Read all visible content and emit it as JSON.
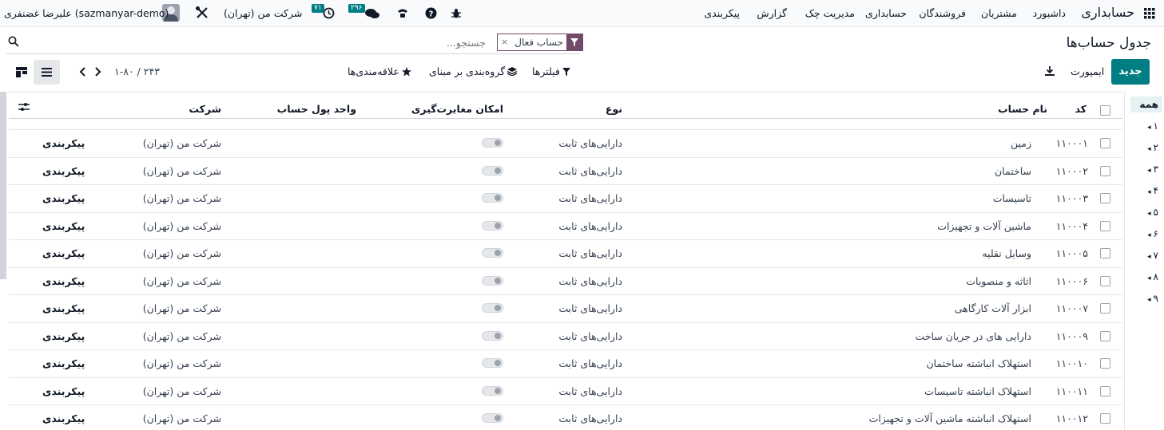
{
  "navbar": {
    "app_name": "حسابداری",
    "menu": [
      "داشبورد",
      "مشتریان",
      "فروشندگان",
      "حسابداری",
      "مدیریت چک",
      "گزارش",
      "پیکربندی"
    ],
    "activity_count": "۲۹۶",
    "clock_count": "۷۱",
    "company": "شرکت من (تهران)",
    "user": "علیرضا غضنفری (sazmanyar-demo)"
  },
  "control": {
    "breadcrumb": "جدول حساب‌ها",
    "new_button": "جدید",
    "import_label": "ایمپورت",
    "facet_label": "حساب فعال",
    "search_placeholder": "جستجو...",
    "filters_label": "فیلترها",
    "groupby_label": "گروه‌بندی بر مبنای",
    "favorites_label": "علاقه‌مندی‌ها",
    "pager": "۱-۸۰ / ۲۴۳"
  },
  "table": {
    "headers": {
      "code": "کد",
      "name": "نام حساب",
      "type": "نوع",
      "reconcile": "امکان مغایرت‌گیری",
      "currency": "واحد پول حساب",
      "company": "شرکت"
    },
    "rows": [
      {
        "code": "۱۱۰۰۰۱",
        "name": "زمین",
        "type": "دارایی‌های ثابت",
        "company": "شرکت من (تهران)",
        "action": "پیکربندی"
      },
      {
        "code": "۱۱۰۰۰۲",
        "name": "ساختمان",
        "type": "دارایی‌های ثابت",
        "company": "شرکت من (تهران)",
        "action": "پیکربندی"
      },
      {
        "code": "۱۱۰۰۰۳",
        "name": "تاسیسات",
        "type": "دارایی‌های ثابت",
        "company": "شرکت من (تهران)",
        "action": "پیکربندی"
      },
      {
        "code": "۱۱۰۰۰۴",
        "name": "ماشین آلات و تجهیزات",
        "type": "دارایی‌های ثابت",
        "company": "شرکت من (تهران)",
        "action": "پیکربندی"
      },
      {
        "code": "۱۱۰۰۰۵",
        "name": "وسایل نقلیه",
        "type": "دارایی‌های ثابت",
        "company": "شرکت من (تهران)",
        "action": "پیکربندی"
      },
      {
        "code": "۱۱۰۰۰۶",
        "name": "اثاثه و منصوبات",
        "type": "دارایی‌های ثابت",
        "company": "شرکت من (تهران)",
        "action": "پیکربندی"
      },
      {
        "code": "۱۱۰۰۰۷",
        "name": "ابزار آلات کارگاهی",
        "type": "دارایی‌های ثابت",
        "company": "شرکت من (تهران)",
        "action": "پیکربندی"
      },
      {
        "code": "۱۱۰۰۰۹",
        "name": "دارایی های در جریان ساخت",
        "type": "دارایی‌های ثابت",
        "company": "شرکت من (تهران)",
        "action": "پیکربندی"
      },
      {
        "code": "۱۱۰۰۱۰",
        "name": "استهلاک انباشته ساختمان",
        "type": "دارایی‌های ثابت",
        "company": "شرکت من (تهران)",
        "action": "پیکربندی"
      },
      {
        "code": "۱۱۰۰۱۱",
        "name": "استهلاک انباشته تاسیسات",
        "type": "دارایی‌های ثابت",
        "company": "شرکت من (تهران)",
        "action": "پیکربندی"
      },
      {
        "code": "۱۱۰۰۱۲",
        "name": "استهلاک انباشته ماشین آلات و تجهیزات",
        "type": "دارایی‌های ثابت",
        "company": "شرکت من (تهران)",
        "action": "پیکربندی"
      }
    ]
  },
  "side_panel": {
    "items": [
      "همه",
      "۱",
      "۲",
      "۳",
      "۴",
      "۵",
      "۶",
      "۷",
      "۸",
      "۹"
    ]
  },
  "colors": {
    "accent": "#017e84",
    "brand": "#714b67"
  }
}
